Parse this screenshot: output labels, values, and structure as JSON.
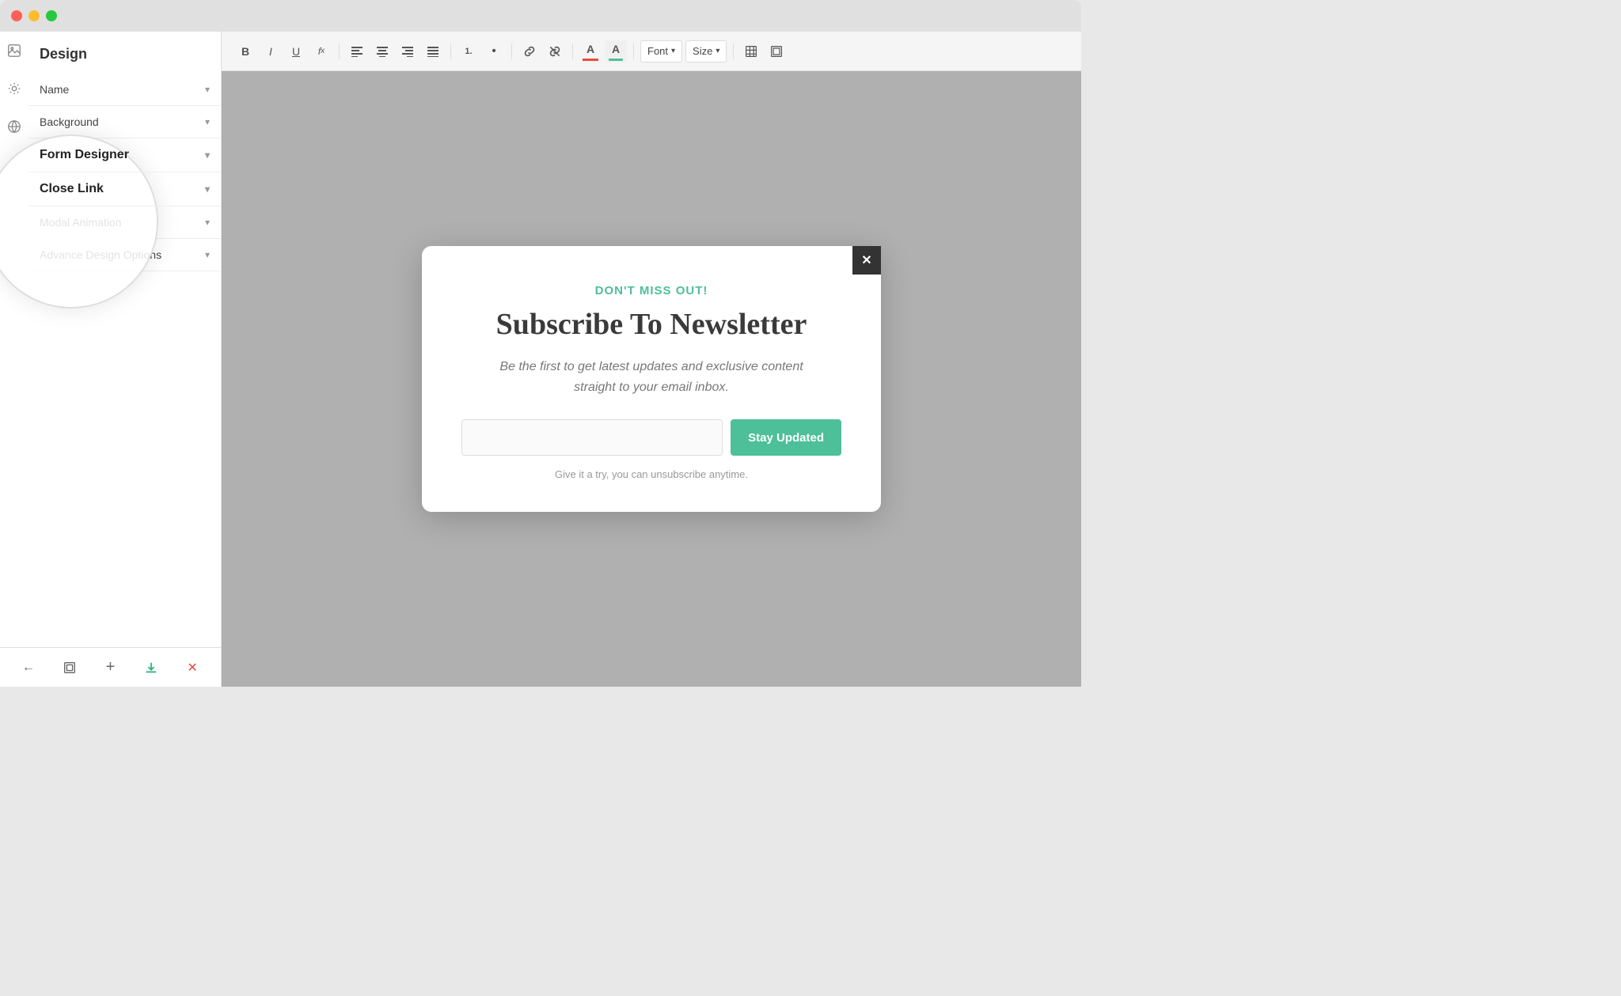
{
  "titlebar": {
    "close_label": "",
    "min_label": "",
    "max_label": ""
  },
  "sidebar": {
    "title": "Design",
    "sections": [
      {
        "id": "name",
        "label": "Name",
        "active": false
      },
      {
        "id": "background",
        "label": "Background",
        "active": false
      },
      {
        "id": "form-designer",
        "label": "Form Designer",
        "active": true
      },
      {
        "id": "close-link",
        "label": "Close Link",
        "active": false
      },
      {
        "id": "modal-animation",
        "label": "Modal Animation",
        "active": false
      },
      {
        "id": "advance-design-options",
        "label": "Advance Design Options",
        "active": false
      }
    ]
  },
  "toolbar": {
    "bold": "B",
    "italic": "I",
    "underline": "U",
    "strikethrough": "𝒻ₓ",
    "align_left": "≡",
    "align_center": "≡",
    "align_right": "≡",
    "align_justify": "≡",
    "ordered_list": "1.",
    "unordered_list": "•",
    "link": "🔗",
    "unlink": "🚫",
    "font_color": "A",
    "highlight": "A",
    "font_label": "Font",
    "size_label": "Size",
    "table_icon": "⊞",
    "source_icon": "⊡"
  },
  "modal": {
    "eyebrow": "DON'T MISS OUT!",
    "headline": "Subscribe To Newsletter",
    "subtext": "Be the first to get latest updates and exclusive content\nstraight to your email inbox.",
    "input_placeholder": "",
    "submit_button": "Stay Updated",
    "fine_print": "Give it a try, you can unsubscribe anytime.",
    "close_icon": "✕"
  },
  "bottom_toolbar": {
    "back_icon": "←",
    "frame_icon": "⬜",
    "add_icon": "+",
    "download_icon": "↓",
    "close_icon": "✕"
  }
}
